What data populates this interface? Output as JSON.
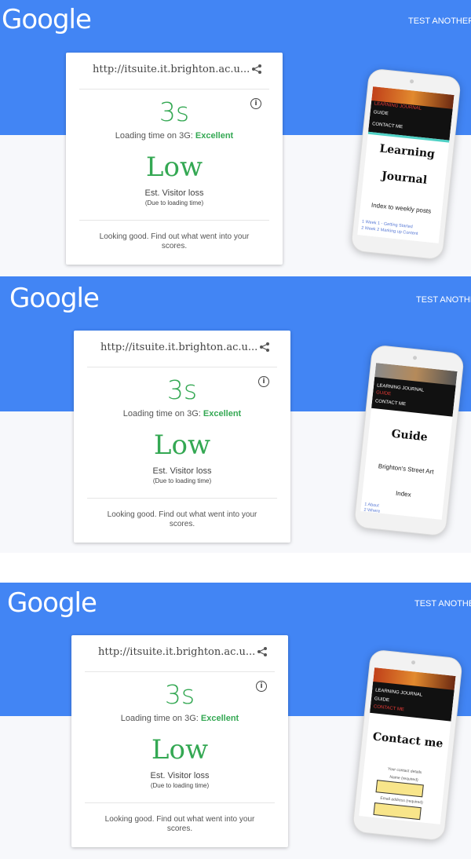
{
  "logo": "Google",
  "test_another": "TEST ANOTHER U",
  "test_another_short": "TEST ANOTHER",
  "card": {
    "url": "http://itsuite.it.brighton.ac.u...",
    "time": "3s",
    "load_prefix": "Loading time on 3G:",
    "rating": "Excellent",
    "loss": "Low",
    "loss_label": "Est. Visitor loss",
    "loss_note": "(Due to loading time)",
    "summary": "Looking good. Find out what went into your scores."
  },
  "phones": [
    {
      "nav": [
        "LEARNING JOURNAL",
        "GUIDE",
        "CONTACT ME"
      ],
      "heading": [
        "Learning",
        "Journal"
      ],
      "subheading": "Index to weekly posts",
      "links": [
        "1 Week 1 - Getting Started",
        "2 Week 2 Marking up Content"
      ]
    },
    {
      "nav": [
        "LEARNING JOURNAL",
        "GUIDE",
        "CONTACT ME"
      ],
      "heading": [
        "Guide"
      ],
      "subheading": "Brighton's Street Art",
      "subheading2": "Index",
      "links": [
        "1 About",
        "2 Where"
      ]
    },
    {
      "nav": [
        "LEARNING JOURNAL",
        "GUIDE",
        "CONTACT ME"
      ],
      "heading": [
        "Contact me"
      ],
      "form_title": "Your contact details",
      "field1": "Name (required)",
      "field2": "Email address (required)"
    }
  ],
  "colors": {
    "blue": "#4285f4",
    "green": "#34a853"
  }
}
